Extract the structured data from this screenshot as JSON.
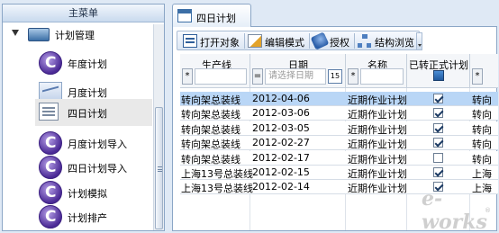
{
  "sidebar": {
    "header": "主菜单",
    "root_label": "计划管理",
    "items": [
      {
        "label": "年度计划",
        "icon": "plan-c-icon"
      },
      {
        "label": "月度计划",
        "icon": "chart-icon"
      },
      {
        "label": "四日计划",
        "icon": "document-icon",
        "selected": true
      },
      {
        "label": "月度计划导入",
        "icon": "plan-c-icon"
      },
      {
        "label": "四日计划导入",
        "icon": "plan-c-icon"
      },
      {
        "label": "计划模拟",
        "icon": "plan-c-icon"
      },
      {
        "label": "计划排产",
        "icon": "plan-c-icon"
      }
    ]
  },
  "tab": {
    "label": "四日计划",
    "icon": "calendar-icon"
  },
  "toolbar": {
    "open": "打开对象",
    "edit_mode": "编辑模式",
    "authorize": "授权",
    "structure": "结构浏览"
  },
  "grid": {
    "columns": {
      "line": "生产线",
      "date": "日期",
      "name": "名称",
      "official": "已转正式计划"
    },
    "filters": {
      "line_op": "*",
      "date_op": "=",
      "date_placeholder": "请选择日期",
      "date_button": "15",
      "name_op": "*",
      "extra_op": "*"
    },
    "rows": [
      {
        "line": "转向架总装线",
        "date": "2012-04-06",
        "name": "近期作业计划",
        "official": true,
        "extra": "转向",
        "selected": true
      },
      {
        "line": "转向架总装线",
        "date": "2012-03-06",
        "name": "近期作业计划",
        "official": true,
        "extra": "转向"
      },
      {
        "line": "转向架总装线",
        "date": "2012-03-05",
        "name": "近期作业计划",
        "official": true,
        "extra": "转向"
      },
      {
        "line": "转向架总装线",
        "date": "2012-02-27",
        "name": "近期作业计划",
        "official": true,
        "extra": "转向"
      },
      {
        "line": "转向架总装线",
        "date": "2012-02-17",
        "name": "近期作业计划",
        "official": false,
        "extra": "转向"
      },
      {
        "line": "上海13号总装线",
        "date": "2012-02-15",
        "name": "近期作业计划",
        "official": true,
        "extra": "上海"
      },
      {
        "line": "上海13号总装线",
        "date": "2012-02-14",
        "name": "近期作业计划",
        "official": true,
        "extra": "上海"
      }
    ]
  },
  "watermark": {
    "text": "e-works",
    "reg": "®"
  },
  "colors": {
    "selection": "#b9d6f6",
    "accent": "#3c6fa6",
    "plan_icon": "#4b2a96"
  }
}
